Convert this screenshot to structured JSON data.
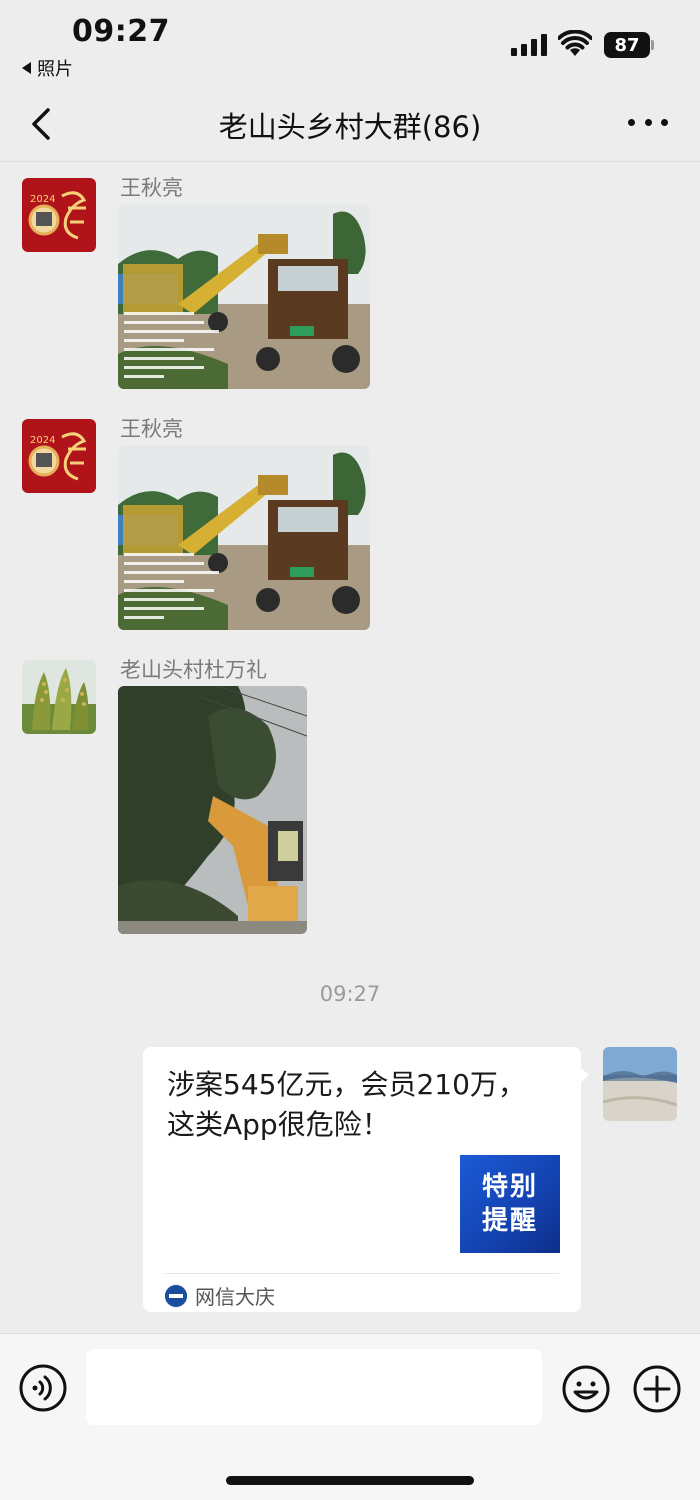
{
  "status_bar": {
    "time": "09:27",
    "back_app": "照片",
    "battery": "87"
  },
  "nav": {
    "title": "老山头乡村大群(86)"
  },
  "messages": [
    {
      "sender": "王秋亮",
      "type": "image"
    },
    {
      "sender": "王秋亮",
      "type": "image"
    },
    {
      "sender": "老山头村杜万礼",
      "type": "image"
    }
  ],
  "timestamp": "09:27",
  "link_card": {
    "title": "涉案545亿元，会员210万，这类App很危险！",
    "thumb_line1": "特别",
    "thumb_line2": "提醒",
    "source": "网信大庆"
  },
  "input_bar": {
    "placeholder": ""
  },
  "icons": {
    "voice": "voice-icon",
    "emoji": "emoji-icon",
    "plus": "plus-icon",
    "back": "chevron-left-icon",
    "more": "more-icon"
  }
}
